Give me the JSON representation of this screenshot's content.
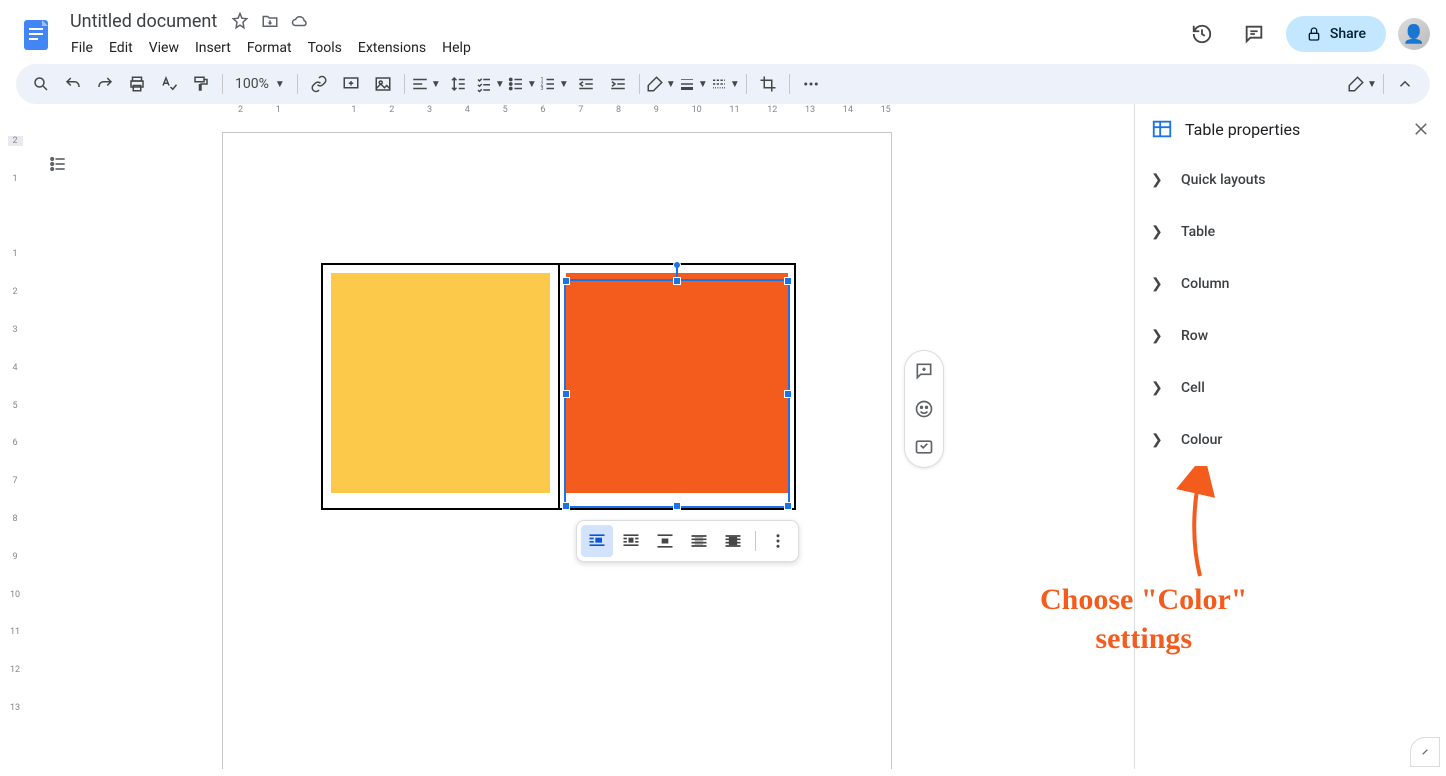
{
  "doc": {
    "title": "Untitled document"
  },
  "menus": [
    "File",
    "Edit",
    "View",
    "Insert",
    "Format",
    "Tools",
    "Extensions",
    "Help"
  ],
  "share_label": "Share",
  "zoom": "100%",
  "ruler_h": [
    "2",
    "1",
    "",
    "1",
    "2",
    "3",
    "4",
    "5",
    "6",
    "7",
    "8",
    "9",
    "10",
    "11",
    "12",
    "13",
    "14",
    "15"
  ],
  "ruler_v": [
    "2",
    "1",
    "",
    "1",
    "2",
    "3",
    "4",
    "5",
    "6",
    "7",
    "8",
    "9",
    "10",
    "11",
    "12",
    "13"
  ],
  "sidepanel": {
    "title": "Table properties",
    "sections": [
      "Quick layouts",
      "Table",
      "Column",
      "Row",
      "Cell",
      "Colour"
    ]
  },
  "annotation": {
    "line1": "Choose \"Color\"",
    "line2": "settings"
  },
  "colors": {
    "yellow": "#fdc94a",
    "orange": "#f35c1d",
    "selection": "#1a73e8"
  }
}
